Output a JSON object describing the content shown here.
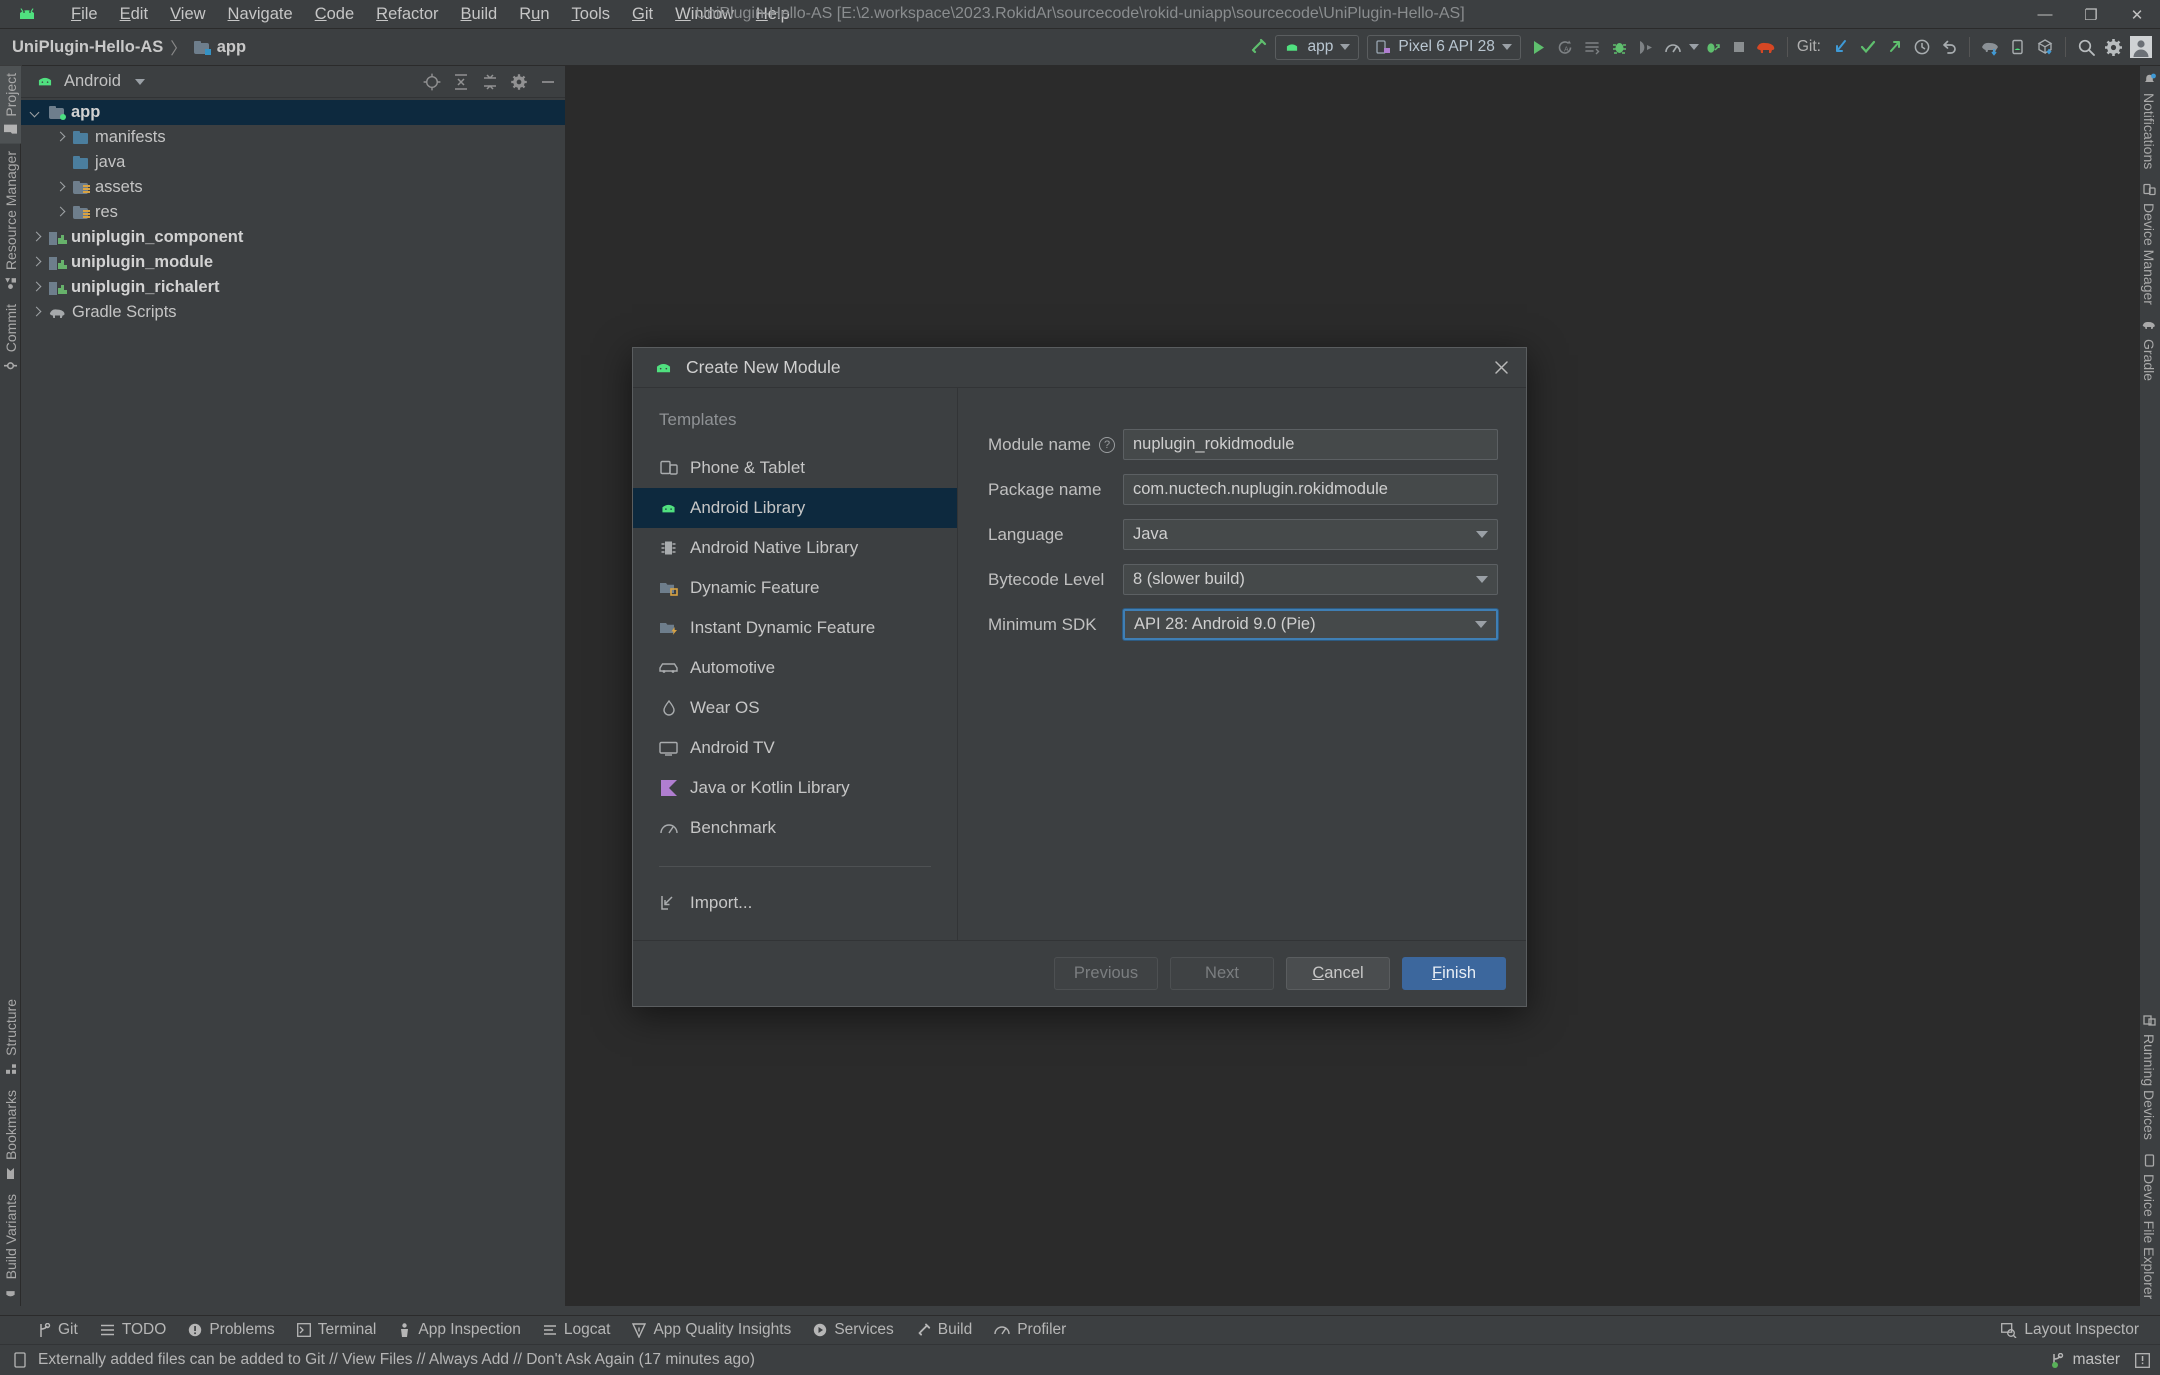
{
  "titlebar": {
    "logo_icon": "android-logo-icon",
    "menus": [
      {
        "label": "File",
        "mnemonic": "F"
      },
      {
        "label": "Edit",
        "mnemonic": "E"
      },
      {
        "label": "View",
        "mnemonic": "V"
      },
      {
        "label": "Navigate",
        "mnemonic": "N"
      },
      {
        "label": "Code",
        "mnemonic": "C"
      },
      {
        "label": "Refactor",
        "mnemonic": "R"
      },
      {
        "label": "Build",
        "mnemonic": "B"
      },
      {
        "label": "Run",
        "mnemonic": "u"
      },
      {
        "label": "Tools",
        "mnemonic": "T"
      },
      {
        "label": "Git",
        "mnemonic": "G"
      },
      {
        "label": "Window",
        "mnemonic": "W"
      },
      {
        "label": "Help",
        "mnemonic": "H"
      }
    ],
    "window_title": "UniPlugin-Hello-AS [E:\\2.workspace\\2023.RokidAr\\sourcecode\\rokid-uniapp\\sourcecode\\UniPlugin-Hello-AS]",
    "minimize": "—",
    "maximize": "❐",
    "close": "✕"
  },
  "navbar": {
    "breadcrumb": {
      "project": "UniPlugin-Hello-AS",
      "separator": "〉",
      "module": "app"
    },
    "run_config": "app",
    "device": "Pixel 6 API 28",
    "git_label": "Git:"
  },
  "left_strip": {
    "top_items": [
      {
        "label": "Project",
        "icon": "project-folder-icon",
        "active": true
      },
      {
        "label": "Resource Manager",
        "icon": "resource-manager-icon",
        "active": false
      },
      {
        "label": "Commit",
        "icon": "commit-icon",
        "active": false
      }
    ],
    "bottom_items": [
      {
        "label": "Structure",
        "icon": "structure-icon"
      },
      {
        "label": "Bookmarks",
        "icon": "bookmark-icon"
      },
      {
        "label": "Build Variants",
        "icon": "build-variants-icon"
      }
    ]
  },
  "right_strip": {
    "top_items": [
      {
        "label": "Notifications",
        "icon": "notifications-icon"
      },
      {
        "label": "Device Manager",
        "icon": "device-manager-icon"
      },
      {
        "label": "Gradle",
        "icon": "gradle-elephant-icon"
      }
    ],
    "bottom_items": [
      {
        "label": "Running Devices",
        "icon": "running-devices-icon"
      },
      {
        "label": "Device File Explorer",
        "icon": "device-file-explorer-icon"
      }
    ]
  },
  "project_panel": {
    "view_name": "Android",
    "tree": [
      {
        "label": "app",
        "indent": 0,
        "arrow": "down",
        "icon": "module-folder-icon",
        "bold": true,
        "selected": true
      },
      {
        "label": "manifests",
        "indent": 1,
        "arrow": "right",
        "icon": "blue-folder-icon",
        "bold": false,
        "selected": false
      },
      {
        "label": "java",
        "indent": 1,
        "arrow": "none",
        "icon": "blue-folder-icon",
        "bold": false,
        "selected": false
      },
      {
        "label": "assets",
        "indent": 1,
        "arrow": "right",
        "icon": "resource-folder-icon",
        "bold": false,
        "selected": false
      },
      {
        "label": "res",
        "indent": 1,
        "arrow": "right",
        "icon": "resource-folder-icon",
        "bold": false,
        "selected": false
      },
      {
        "label": "uniplugin_component",
        "indent": 0,
        "arrow": "right",
        "icon": "module-icon",
        "bold": true,
        "selected": false
      },
      {
        "label": "uniplugin_module",
        "indent": 0,
        "arrow": "right",
        "icon": "module-icon",
        "bold": true,
        "selected": false
      },
      {
        "label": "uniplugin_richalert",
        "indent": 0,
        "arrow": "right",
        "icon": "module-icon",
        "bold": true,
        "selected": false
      },
      {
        "label": "Gradle Scripts",
        "indent": 0,
        "arrow": "right",
        "icon": "gradle-elephant-icon",
        "bold": false,
        "selected": false
      }
    ]
  },
  "dialog": {
    "title": "Create New Module",
    "title_icon": "android-logo-icon",
    "close_icon": "close-icon",
    "templates_header": "Templates",
    "templates": [
      {
        "label": "Phone & Tablet",
        "icon": "phone-tablet-icon",
        "selected": false
      },
      {
        "label": "Android Library",
        "icon": "android-logo-icon",
        "selected": true
      },
      {
        "label": "Android Native Library",
        "icon": "native-library-icon",
        "selected": false
      },
      {
        "label": "Dynamic Feature",
        "icon": "dynamic-feature-icon",
        "selected": false
      },
      {
        "label": "Instant Dynamic Feature",
        "icon": "instant-dynamic-feature-icon",
        "selected": false
      },
      {
        "label": "Automotive",
        "icon": "automotive-car-icon",
        "selected": false
      },
      {
        "label": "Wear OS",
        "icon": "wear-os-icon",
        "selected": false
      },
      {
        "label": "Android TV",
        "icon": "android-tv-icon",
        "selected": false
      },
      {
        "label": "Java or Kotlin Library",
        "icon": "kotlin-icon",
        "selected": false
      },
      {
        "label": "Benchmark",
        "icon": "benchmark-icon",
        "selected": false
      }
    ],
    "import_label": "Import...",
    "import_icon": "import-icon",
    "fields": {
      "module_name": {
        "label": "Module name",
        "value": "nuplugin_rokidmodule",
        "has_help": true,
        "help_icon": "help-circle-icon"
      },
      "package_name": {
        "label": "Package name",
        "value": "com.nuctech.nuplugin.rokidmodule"
      },
      "language": {
        "label": "Language",
        "value": "Java"
      },
      "bytecode_level": {
        "label": "Bytecode Level",
        "value": "8 (slower build)"
      },
      "minimum_sdk": {
        "label": "Minimum SDK",
        "value": "API 28: Android 9.0 (Pie)",
        "focused": true
      }
    },
    "buttons": {
      "previous": {
        "label": "Previous",
        "disabled": true
      },
      "next": {
        "label": "Next",
        "disabled": true
      },
      "cancel": {
        "label": "Cancel",
        "mnemonic": "C"
      },
      "finish": {
        "label": "Finish",
        "mnemonic": "F",
        "primary": true
      }
    }
  },
  "bottom_tools": {
    "items": [
      {
        "label": "Git",
        "icon": "git-branch-icon"
      },
      {
        "label": "TODO",
        "icon": "todo-icon"
      },
      {
        "label": "Problems",
        "icon": "problems-icon"
      },
      {
        "label": "Terminal",
        "icon": "terminal-icon"
      },
      {
        "label": "App Inspection",
        "icon": "app-inspection-icon"
      },
      {
        "label": "Logcat",
        "icon": "logcat-icon"
      },
      {
        "label": "App Quality Insights",
        "icon": "app-quality-insights-icon"
      },
      {
        "label": "Services",
        "icon": "services-icon"
      },
      {
        "label": "Build",
        "icon": "build-hammer-icon"
      },
      {
        "label": "Profiler",
        "icon": "profiler-icon"
      }
    ],
    "layout_inspector": {
      "label": "Layout Inspector",
      "icon": "layout-inspector-icon"
    }
  },
  "status_bar": {
    "message": "Externally added files can be added to Git // View Files // Always Add // Don't Ask Again (17 minutes ago)",
    "message_icon": "notification-doc-icon",
    "branch": "master",
    "branch_icon": "git-branch-icon",
    "event_icon": "event-log-icon"
  },
  "colors": {
    "accent_blue": "#3c679d",
    "selection_blue": "#0d293e",
    "android_green": "#50e07f",
    "panel_bg": "#3c3f41",
    "editor_bg": "#2b2b2b",
    "focus_border": "#3f7fb5"
  }
}
